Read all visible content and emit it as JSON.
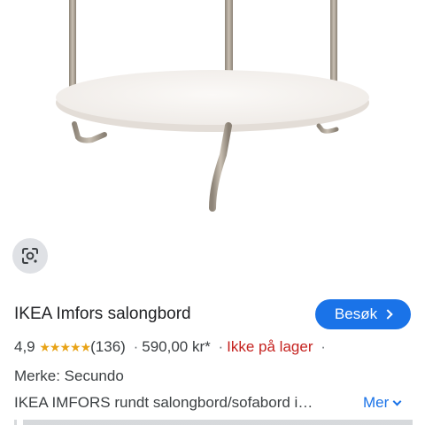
{
  "product": {
    "title": "IKEA Imfors salongbord",
    "rating": "4,9",
    "stars": "★★★★★",
    "review_count": "(136)",
    "price": "590,00 kr*",
    "stock_status": "Ikke på lager",
    "separator": "·",
    "brand": "Merke: Secundo",
    "description": "IKEA IMFORS rundt salongbord/sofabord i…",
    "image_icon": "round-white-coffee-table-image"
  },
  "actions": {
    "visit_label": "Besøk",
    "more_label": "Mer",
    "lens_icon": "google-lens-icon"
  },
  "colors": {
    "accent": "#1a73e8",
    "stars": "#e8a317",
    "out_of_stock": "#c5221f"
  }
}
